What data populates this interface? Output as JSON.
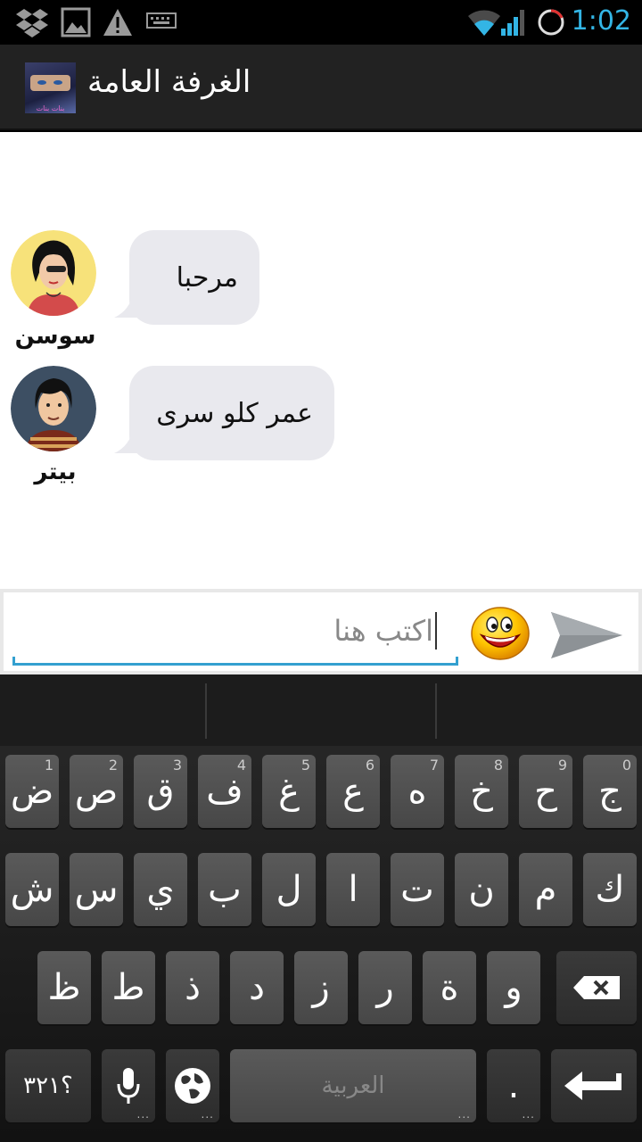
{
  "status_bar": {
    "time": "1:02",
    "icons": [
      "dropbox-icon",
      "gallery-icon",
      "warning-icon",
      "keyboard-icon",
      "wifi-icon",
      "signal-icon",
      "sync-icon"
    ],
    "accent": "#33b5e5"
  },
  "action_bar": {
    "title": "الغرفة العامة",
    "logo_text": "بنات بنات"
  },
  "messages": [
    {
      "sender": "سوسن",
      "text": "مرحبا",
      "avatar_icon": "avatar-female-icon"
    },
    {
      "sender": "بيتر",
      "text": "عمر كلو سرى",
      "avatar_icon": "avatar-male-icon"
    }
  ],
  "composer": {
    "placeholder": "اكتب هنا",
    "emoji_icon": "smiley-icon",
    "send_icon": "send-icon"
  },
  "keyboard": {
    "row1": [
      {
        "label": "ض",
        "hint": "1"
      },
      {
        "label": "ص",
        "hint": "2"
      },
      {
        "label": "ق",
        "hint": "3"
      },
      {
        "label": "ف",
        "hint": "4"
      },
      {
        "label": "غ",
        "hint": "5"
      },
      {
        "label": "ع",
        "hint": "6"
      },
      {
        "label": "ه",
        "hint": "7"
      },
      {
        "label": "خ",
        "hint": "8"
      },
      {
        "label": "ح",
        "hint": "9"
      },
      {
        "label": "ج",
        "hint": "0"
      }
    ],
    "row2": [
      "ش",
      "س",
      "ي",
      "ب",
      "ل",
      "ا",
      "ت",
      "ن",
      "م",
      "ك"
    ],
    "row3": [
      "ظ",
      "ط",
      "ذ",
      "د",
      "ز",
      "ر",
      "ة",
      "و"
    ],
    "symbols_label": "؟٣٢١",
    "space_label": "العربية",
    "period_label": ".",
    "backspace_icon": "backspace-icon",
    "enter_icon": "enter-icon",
    "mic_icon": "mic-icon",
    "globe_icon": "globe-icon",
    "more_dots": "..."
  }
}
